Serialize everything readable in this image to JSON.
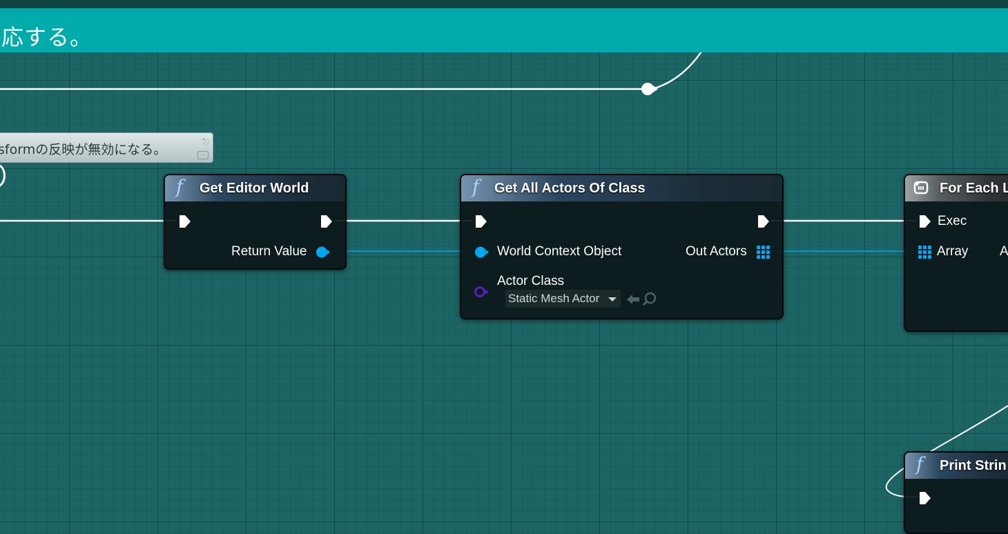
{
  "comment": {
    "header_text": "応する。"
  },
  "sticky_note": {
    "text": "sformの反映が無効になる。"
  },
  "nodes": {
    "get_editor_world": {
      "title": "Get Editor World",
      "icon": "function-f-icon",
      "outputs": {
        "return_value": "Return Value"
      }
    },
    "get_all_actors": {
      "title": "Get All Actors Of Class",
      "icon": "function-f-icon",
      "inputs": {
        "world_context": "World Context Object",
        "actor_class": "Actor Class",
        "actor_class_value": "Static Mesh Actor"
      },
      "outputs": {
        "out_actors": "Out Actors"
      }
    },
    "for_each_loop": {
      "title": "For Each L",
      "icon": "loop-icon",
      "inputs": {
        "exec": "Exec",
        "array": "Array"
      },
      "outputs": {
        "partial": "A"
      }
    },
    "print_string": {
      "title": "Print Strin",
      "icon": "function-f-icon"
    }
  },
  "colors": {
    "object_pin": "#00a8f2",
    "class_pin": "#5a1cbf",
    "exec_wire": "#ffffff",
    "comment_header": "#00abab",
    "graph_background": "#1d6464"
  }
}
